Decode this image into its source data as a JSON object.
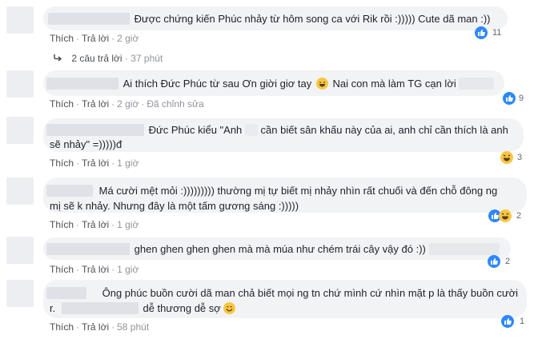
{
  "comments": [
    {
      "text_lines": [
        "Được chứng kiến Phúc nhảy từ hôm song ca với Rik rồi :))))) Cute dã man :))"
      ],
      "reply_label": "Thích",
      "reply_btn": "Trả lời",
      "time": "2 giờ",
      "reaction_count": "11",
      "reaction_type": "like"
    },
    {
      "text_lines": [
        "Ai thích Đức Phúc từ sau Ơn giời giơ tay",
        "Nai con mà làm TG cạn lời"
      ],
      "reply_label": "Thích",
      "reply_btn": "Trả lời",
      "time": "2 giờ",
      "edited": "Đã chỉnh sửa",
      "reaction_count": "9",
      "reaction_type": "like"
    },
    {
      "text_lines": [
        "Đức Phúc kiểu \"Anh",
        "cần biết sân khấu này của ai, anh chỉ cần thích là anh",
        "sẽ nhảy\" =)))))đ"
      ],
      "reply_label": "Thích",
      "reply_btn": "Trả lời",
      "time": "1 giờ",
      "reaction_count": "3",
      "reaction_type": "haha"
    },
    {
      "text_lines": [
        "Má cười mệt mỏi :))))))))) thường mị tự biết mị nhảy nhìn rất chuối và đến chỗ đông ng",
        "mị sẽ k nhảy. Nhưng đây là một tấm gương sáng :)))))"
      ],
      "reply_label": "Thích",
      "reply_btn": "Trả lời",
      "time": "1 giờ",
      "reaction_count": "2",
      "reaction_type": "like-haha"
    },
    {
      "text_lines": [
        "ghen ghen ghen ghen mà mà múa như chém trái cây vậy đó :))"
      ],
      "reply_label": "Thích",
      "reply_btn": "Trả lời",
      "time": "1 giờ",
      "reaction_count": "2",
      "reaction_type": "like"
    },
    {
      "text_lines": [
        "Ông phúc buồn cười dã man chả biết mọi ng tn chứ mình cứ nhìn mặt p là thấy buồn cười",
        "r.",
        "dễ thương dễ sợ"
      ],
      "reply_label": "Thích",
      "reply_btn": "Trả lời",
      "time": "58 phút",
      "reaction_count": "1",
      "reaction_type": "like"
    }
  ],
  "replies_link": {
    "label": "2 câu trả lời",
    "time": "37 phút"
  },
  "colors": {
    "bubble": "#f2f3f5",
    "link": "#4b4f56",
    "meta": "#90949c",
    "like": "#2d88ff",
    "haha": "#f7c743"
  }
}
